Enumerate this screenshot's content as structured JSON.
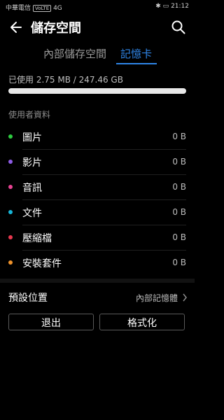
{
  "status_bar": {
    "carrier": "中華電信",
    "badge": "VoLTE",
    "network": "4G",
    "time": "21:12"
  },
  "toolbar": {
    "title": "儲存空間",
    "back_icon": "arrow-left-icon",
    "search_icon": "search-icon"
  },
  "tabs": [
    {
      "label": "內部儲存空間",
      "active": false
    },
    {
      "label": "記憶卡",
      "active": true
    }
  ],
  "usage": {
    "text": "已使用 2.75 MB / 247.46 GB",
    "fraction": 1
  },
  "section_title": "使用者資料",
  "categories": [
    {
      "label": "圖片",
      "value": "0 B",
      "color": "#2ecc40"
    },
    {
      "label": "影片",
      "value": "0 B",
      "color": "#8e5ce6"
    },
    {
      "label": "音訊",
      "value": "0 B",
      "color": "#e84393"
    },
    {
      "label": "文件",
      "value": "0 B",
      "color": "#17b5d8"
    },
    {
      "label": "壓縮檔",
      "value": "0 B",
      "color": "#e8384f"
    },
    {
      "label": "安裝套件",
      "value": "0 B",
      "color": "#f0932b"
    }
  ],
  "default_location": {
    "label": "預設位置",
    "value": "內部記憶體"
  },
  "buttons": {
    "exit": "退出",
    "format": "格式化"
  }
}
